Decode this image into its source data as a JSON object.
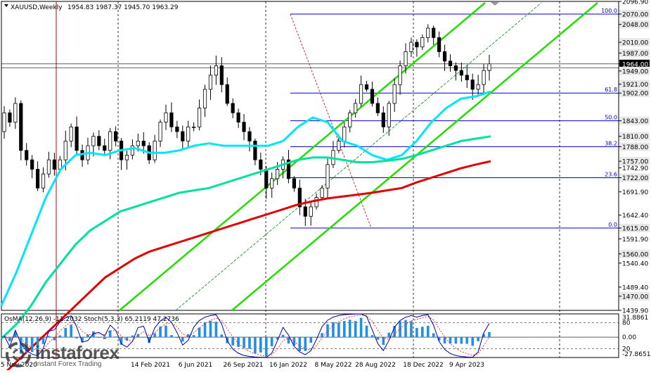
{
  "header": {
    "symbol": "XAUUSD,Weekly",
    "ohlc": "1954.83 1987.37 1945.70 1963.29"
  },
  "oscillator_label": "OsMA(12,26,9) -11.2032  Stoch(5,3,3) 65.2119 47.2736",
  "watermark": {
    "brand": "instaforex",
    "tagline": "Instant Forex Trading"
  },
  "colors": {
    "bull_candle": "#000000",
    "bear_candle": "#000000",
    "ema_fast": "#00e5ff",
    "ema_mid": "#00e0a0",
    "ema_slow": "#e00000",
    "channel": "#22dd00",
    "fibo": "#0000cc",
    "osma_bars": "#1f8fe8",
    "stoch_main": "#0000aa",
    "stoch_signal": "#ff0000",
    "current_price_box": "#000000"
  },
  "chart_data": {
    "type": "candlestick",
    "symbol": "XAUUSD",
    "timeframe": "Weekly",
    "ylim": [
      1439.9,
      2096.9
    ],
    "y_ticks": [
      "2096.90",
      "2070.00",
      "2048.00",
      "2010.00",
      "1987.00",
      "1964.00",
      "1949.00",
      "1921.00",
      "1902.00",
      "1843.00",
      "1810.00",
      "1788.00",
      "1757.00",
      "1742.90",
      "1722.00",
      "1691.90",
      "1642.40",
      "1615.00",
      "1591.90",
      "1560.00",
      "1540.40",
      "1489.40",
      "1470.00",
      "1439.90"
    ],
    "highlight_ticks": [
      "2070.00",
      "2048.00",
      "2010.00",
      "1987.00",
      "1964.00",
      "1949.00",
      "1921.00",
      "1902.00",
      "1843.00",
      "1810.00",
      "1788.00",
      "1757.00",
      "1722.00",
      "1615.00",
      "1560.00",
      "1470.00"
    ],
    "current_price": "1964.00",
    "x_ticks": [
      "15 Nov 2020",
      "14 Feb 2021",
      "6 Jun 2021",
      "26 Sep 2021",
      "16 Jan 2022",
      "8 May 2022",
      "28 Aug 2022",
      "18 Dec 2022",
      "9 Apr 2023"
    ],
    "fibonacci": {
      "high": 2070.0,
      "low": 1615.0,
      "levels": [
        {
          "label": "100.0",
          "value": 2070.0
        },
        {
          "label": "61.8",
          "value": 1902.0
        },
        {
          "label": "50.0",
          "value": 1843.0
        },
        {
          "label": "38.2",
          "value": 1788.0
        },
        {
          "label": "23.6",
          "value": 1722.0
        },
        {
          "label": "0.0",
          "value": 1615.0
        }
      ]
    },
    "moving_averages": [
      {
        "key": "ema_fast",
        "values": [
          1450,
          1520,
          1600,
          1680,
          1740,
          1770,
          1775,
          1770,
          1780,
          1785,
          1775,
          1775,
          1780,
          1790,
          1795,
          1790,
          1790,
          1790,
          1790,
          1800,
          1830,
          1850,
          1840,
          1800,
          1790,
          1770,
          1760,
          1770,
          1800,
          1840,
          1870,
          1890,
          1895,
          1905
        ]
      },
      {
        "key": "ema_mid",
        "values": [
          1380,
          1410,
          1450,
          1500,
          1540,
          1580,
          1610,
          1630,
          1650,
          1660,
          1670,
          1680,
          1690,
          1695,
          1700,
          1710,
          1720,
          1730,
          1740,
          1750,
          1760,
          1765,
          1765,
          1760,
          1755,
          1755,
          1758,
          1762,
          1770,
          1780,
          1790,
          1800,
          1805,
          1810
        ]
      },
      {
        "key": "ema_slow",
        "values": [
          1300,
          1330,
          1360,
          1390,
          1420,
          1450,
          1480,
          1510,
          1530,
          1550,
          1565,
          1575,
          1585,
          1595,
          1605,
          1615,
          1625,
          1635,
          1645,
          1655,
          1665,
          1672,
          1678,
          1682,
          1686,
          1690,
          1695,
          1700,
          1712,
          1722,
          1732,
          1742,
          1750,
          1757
        ]
      }
    ],
    "channel_lines": [
      {
        "p1": [
          "10 Jan 2021",
          1439.9
        ],
        "p2": [
          "20 Jun 2023",
          2096.9
        ]
      },
      {
        "p1": [
          "29 Aug 2021",
          1439.9
        ],
        "p2": [
          "25 Dec 2023",
          2070.0
        ]
      }
    ],
    "weekly_close_approx": [
      1860,
      1840,
      1880,
      1780,
      1760,
      1740,
      1700,
      1730,
      1760,
      1740,
      1760,
      1800,
      1830,
      1780,
      1760,
      1790,
      1810,
      1790,
      1780,
      1820,
      1800,
      1760,
      1770,
      1790,
      1800,
      1790,
      1760,
      1800,
      1840,
      1860,
      1830,
      1820,
      1800,
      1830,
      1830,
      1870,
      1910,
      1940,
      1960,
      1920,
      1880,
      1860,
      1840,
      1820,
      1800,
      1760,
      1740,
      1700,
      1720,
      1740,
      1760,
      1720,
      1700,
      1660,
      1640,
      1660,
      1680,
      1700,
      1750,
      1780,
      1800,
      1830,
      1860,
      1880,
      1920,
      1910,
      1880,
      1860,
      1830,
      1880,
      1920,
      1960,
      1990,
      2010,
      2000,
      2020,
      2040,
      2020,
      1990,
      1970,
      1960,
      1950,
      1940,
      1930,
      1910,
      1920,
      1950,
      1964
    ],
    "oscillator": {
      "osma_ylim": [
        -27.8651,
        31.8861
      ],
      "y_ticks": [
        "31.8861",
        "80",
        "0.00",
        "20",
        "-27.8651"
      ],
      "stoch_levels": [
        80,
        20
      ]
    }
  }
}
